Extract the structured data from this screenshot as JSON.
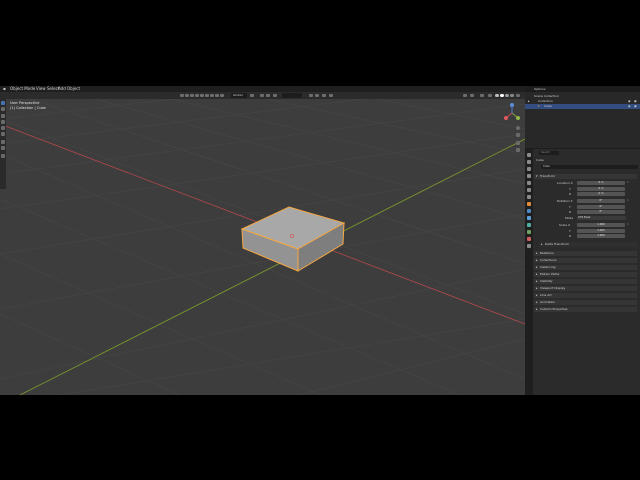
{
  "app": {
    "mode": "Object Mode",
    "menu": [
      "View",
      "Select",
      "Add",
      "Object"
    ],
    "workspace_dropdown": "Global",
    "options_label": "Options"
  },
  "viewport": {
    "view_name": "User Perspective",
    "collection_path": "(1) Collection | Cube"
  },
  "outliner": {
    "rows": [
      "Scene Collection",
      "Collection",
      "Cube"
    ]
  },
  "properties": {
    "search_placeholder": "Search",
    "object_name": "Cube",
    "object_field": "Cube",
    "transform_label": "Transform",
    "location_label": "Location X",
    "location": [
      "0 m",
      "0 m",
      "0 m"
    ],
    "rotation_label": "Rotation X",
    "rotation": [
      "0°",
      "0°",
      "0°"
    ],
    "mode_label": "Mode",
    "mode_value": "XYZ Euler",
    "scale_label": "Scale X",
    "scale": [
      "1.000",
      "1.000",
      "1.000"
    ],
    "axis_y": "Y",
    "axis_z": "Z",
    "delta_label": "Delta Transform",
    "panels": [
      "Relations",
      "Collections",
      "Instancing",
      "Motion Paths",
      "Visibility",
      "Viewport Display",
      "Line Art",
      "Animation",
      "Custom Properties"
    ]
  },
  "colors": {
    "selection_outline": "#f5a742",
    "x_axis": "#b5484d",
    "y_axis": "#7b9a2b",
    "accent": "#4772b3"
  }
}
